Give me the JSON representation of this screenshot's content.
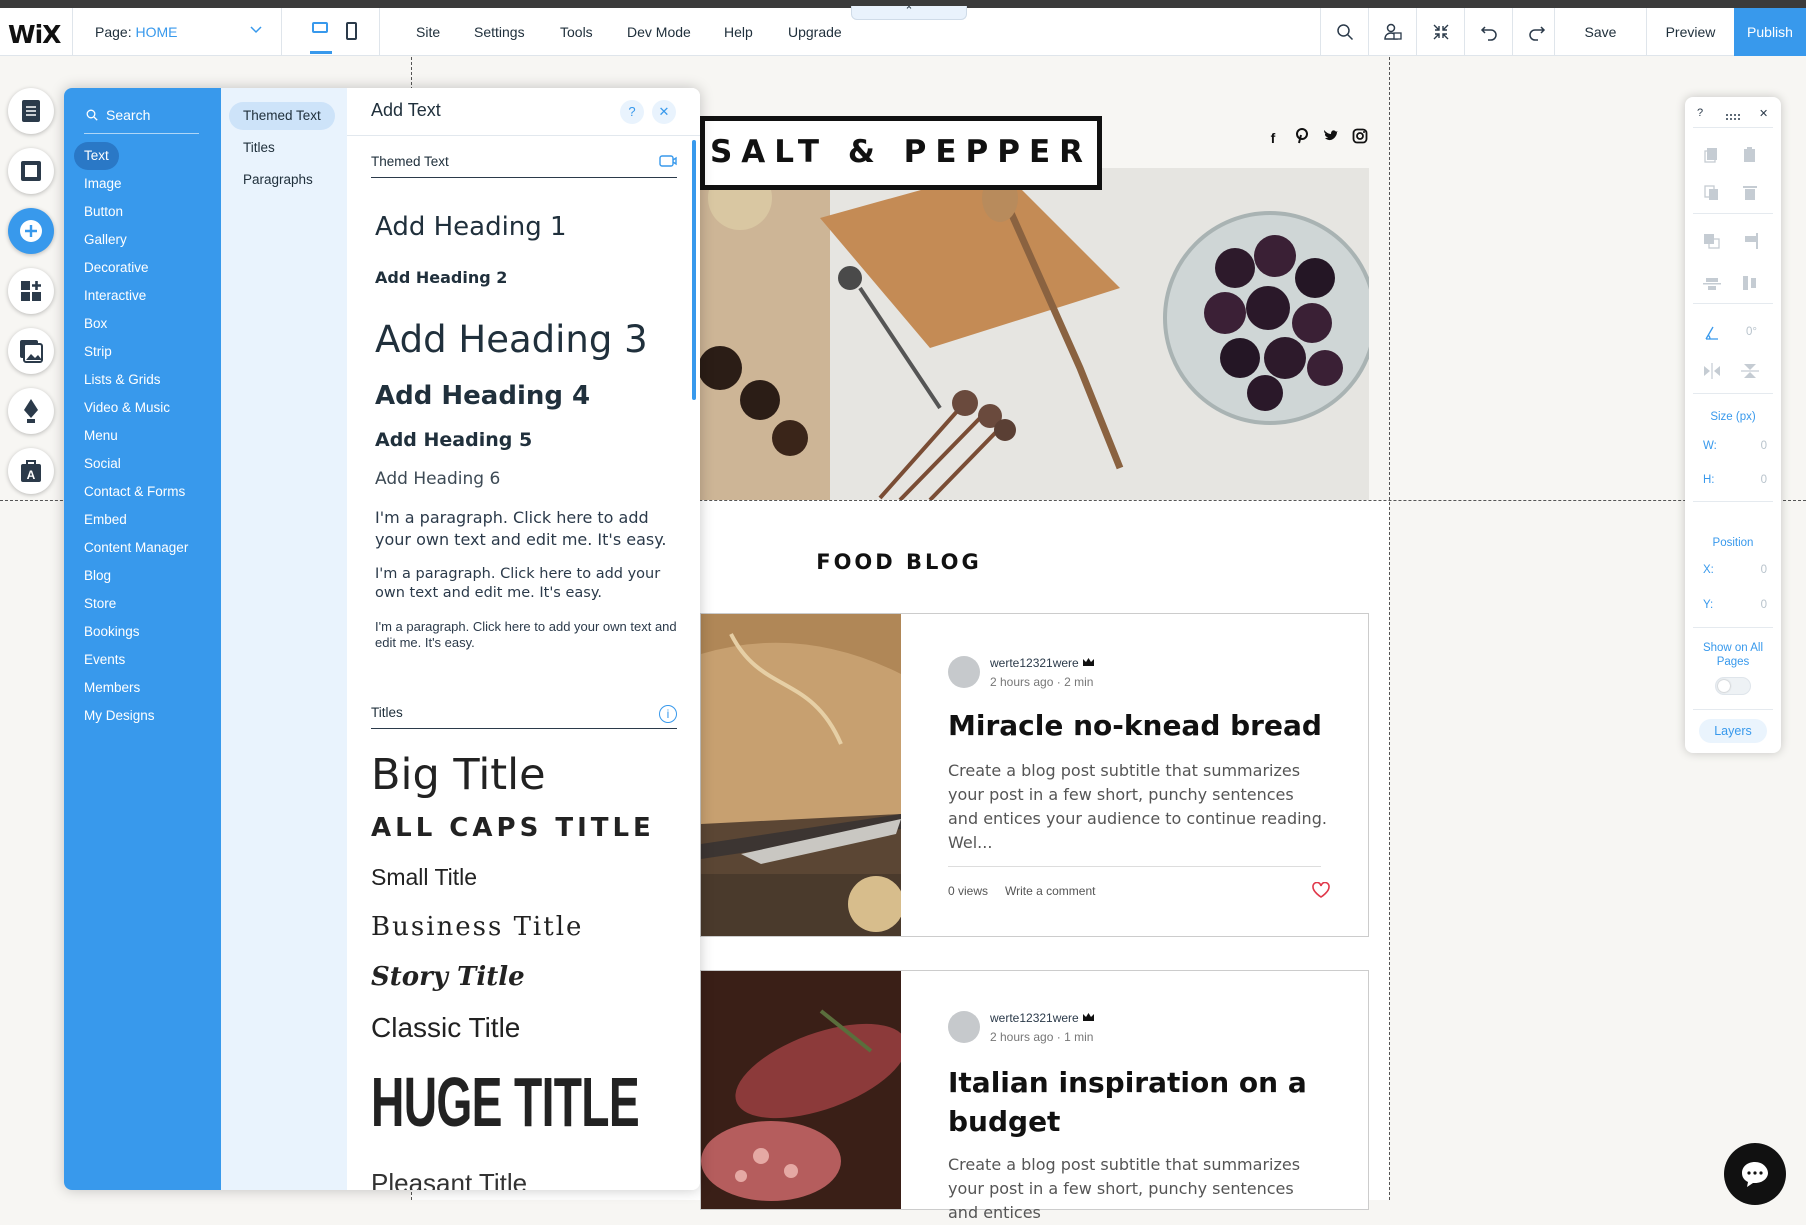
{
  "topbar": {
    "logo": "WiX",
    "page_label": "Page:",
    "page_value": "HOME",
    "menu": [
      "Site",
      "Settings",
      "Tools",
      "Dev Mode",
      "Help",
      "Upgrade"
    ],
    "save": "Save",
    "preview": "Preview",
    "publish": "Publish"
  },
  "add_panel": {
    "search": "Search",
    "categories": [
      "Text",
      "Image",
      "Button",
      "Gallery",
      "Decorative",
      "Interactive",
      "Box",
      "Strip",
      "Lists & Grids",
      "Video & Music",
      "Menu",
      "Social",
      "Contact & Forms",
      "Embed",
      "Content Manager",
      "Blog",
      "Store",
      "Bookings",
      "Events",
      "Members",
      "My Designs"
    ],
    "selected_category": "Text",
    "subcategories": [
      "Themed Text",
      "Titles",
      "Paragraphs"
    ],
    "selected_subcategory": "Themed Text",
    "content_title": "Add Text",
    "help": "?",
    "close": "✕",
    "themed_header": "Themed Text",
    "headings": [
      "Add Heading 1",
      "Add Heading 2",
      "Add Heading 3",
      "Add Heading 4",
      "Add Heading 5",
      "Add Heading 6"
    ],
    "paragraph": "I'm a paragraph. Click here to add your own text and edit me. It's easy.",
    "titles_header": "Titles",
    "titles": [
      "Big Title",
      "ALL CAPS TITLE",
      "Small Title",
      "Business Title",
      "Story Title",
      "Classic Title",
      "HUGE TITLE",
      "Pleasant Title"
    ]
  },
  "site": {
    "brand": "SALT & PEPPER",
    "social_icons": [
      "facebook-icon",
      "pinterest-icon",
      "twitter-icon",
      "instagram-icon"
    ],
    "section_title": "FOOD BLOG",
    "posts": [
      {
        "author": "werte12321were",
        "time": "2 hours ago",
        "read": "2 min",
        "title": "Miracle no-knead bread",
        "excerpt": "Create a blog post subtitle that summarizes your post in a few short, punchy sentences and entices your audience to continue reading. Wel...",
        "views": "0 views",
        "comment": "Write a comment"
      },
      {
        "author": "werte12321were",
        "time": "2 hours ago",
        "read": "1 min",
        "title": "Italian inspiration on a budget",
        "excerpt": "Create a blog post subtitle that summarizes your post in a few short, punchy sentences and entices"
      }
    ]
  },
  "tools_panel": {
    "help": "?",
    "close": "✕",
    "angle": "0°",
    "size_label": "Size (px)",
    "w_label": "W:",
    "w_value": "0",
    "h_label": "H:",
    "h_value": "0",
    "position_label": "Position",
    "x_label": "X:",
    "x_value": "0",
    "y_label": "Y:",
    "y_value": "0",
    "show_all": "Show on All Pages",
    "layers": "Layers"
  },
  "colors": {
    "accent": "#3899ec",
    "heart": "#e0384a"
  }
}
